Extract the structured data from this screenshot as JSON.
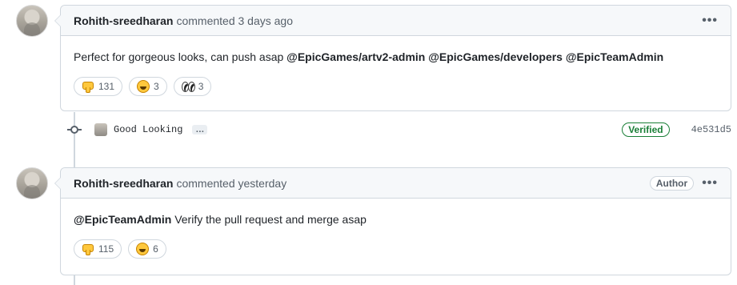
{
  "comments": [
    {
      "author": "Rohith-sreedharan",
      "action": "commented 3 days ago",
      "body_text": "Perfect for gorgeous looks, can push asap ",
      "mentions": [
        "@EpicGames/artv2-admin",
        "@EpicGames/developers",
        "@EpicTeamAdmin"
      ],
      "reactions": [
        {
          "emoji": "thumbs-down-icon",
          "count": "131"
        },
        {
          "emoji": "laugh-icon",
          "count": "3"
        },
        {
          "emoji": "eyes-icon",
          "count": "3"
        }
      ],
      "menu_label": "•••"
    },
    {
      "author": "Rohith-sreedharan",
      "action": "commented yesterday",
      "badge": "Author",
      "mention": "@EpicTeamAdmin",
      "body_text": " Verify the pull request and merge asap",
      "reactions": [
        {
          "emoji": "thumbs-down-icon",
          "count": "115"
        },
        {
          "emoji": "laugh-icon",
          "count": "6"
        }
      ],
      "menu_label": "•••"
    }
  ],
  "commit": {
    "message": "Good Looking",
    "expander": "…",
    "status": "Verified",
    "sha": "4e531d5"
  },
  "colors": {
    "border": "#d0d7de",
    "header_bg": "#f6f8fa",
    "verified_green": "#1a7f37",
    "muted_text": "#57606a"
  }
}
